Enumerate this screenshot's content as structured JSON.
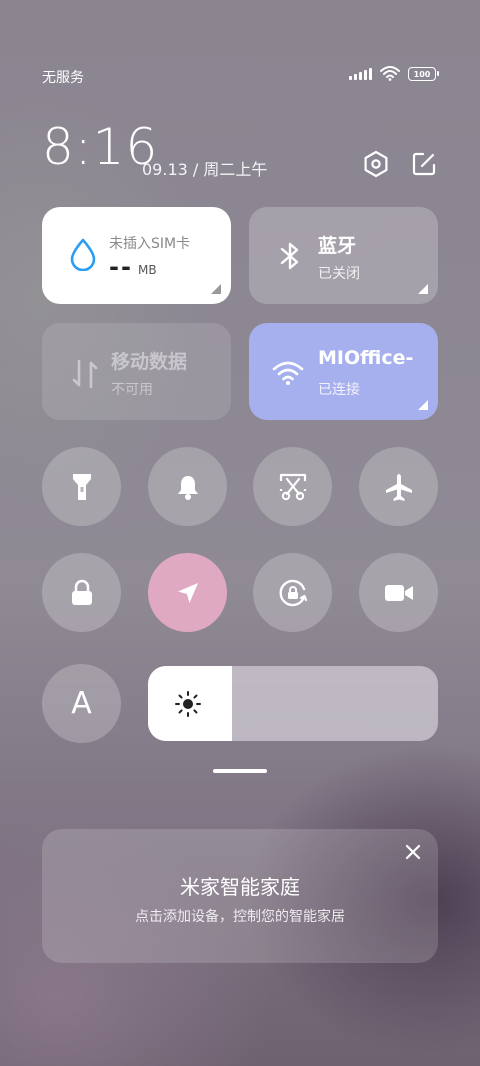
{
  "status_bar": {
    "carrier": "无服务",
    "battery": "100",
    "icons": [
      "signal-icon",
      "wifi-icon",
      "battery-icon"
    ]
  },
  "header": {
    "time": "8:16",
    "date": "09.13 / 周二上午",
    "settings_icon": "gear-hex-icon",
    "edit_icon": "edit-icon"
  },
  "tiles": {
    "data_usage": {
      "title": "未插入SIM卡",
      "value": "--",
      "unit": "MB",
      "icon": "water-drop-icon",
      "accent": "#2a9df4"
    },
    "bluetooth": {
      "title": "蓝牙",
      "status": "已关闭",
      "icon": "bluetooth-icon"
    },
    "mobile_data": {
      "title": "移动数据",
      "status": "不可用",
      "icon": "mobile-data-icon"
    },
    "wifi": {
      "title": "MIOffice-",
      "status": "已连接",
      "icon": "wifi-icon",
      "color": "#a7b0ef"
    }
  },
  "quick_toggles": [
    {
      "name": "flashlight",
      "icon": "flashlight-icon",
      "active": false
    },
    {
      "name": "ringer",
      "icon": "bell-icon",
      "active": false
    },
    {
      "name": "screenshot",
      "icon": "scissors-icon",
      "active": false
    },
    {
      "name": "airplane",
      "icon": "airplane-icon",
      "active": false
    },
    {
      "name": "lock",
      "icon": "lock-icon",
      "active": false
    },
    {
      "name": "location",
      "icon": "location-arrow-icon",
      "active": true,
      "color": "#e0a9c2"
    },
    {
      "name": "rotation-lock",
      "icon": "rotation-lock-icon",
      "active": false
    },
    {
      "name": "screen-record",
      "icon": "video-camera-icon",
      "active": false
    }
  ],
  "auto_brightness": {
    "label": "A"
  },
  "brightness": {
    "level_fraction": 0.29,
    "icon": "sun-icon"
  },
  "mijia_card": {
    "title": "米家智能家庭",
    "subtitle": "点击添加设备，控制您的智能家居",
    "close_icon": "close-icon"
  }
}
